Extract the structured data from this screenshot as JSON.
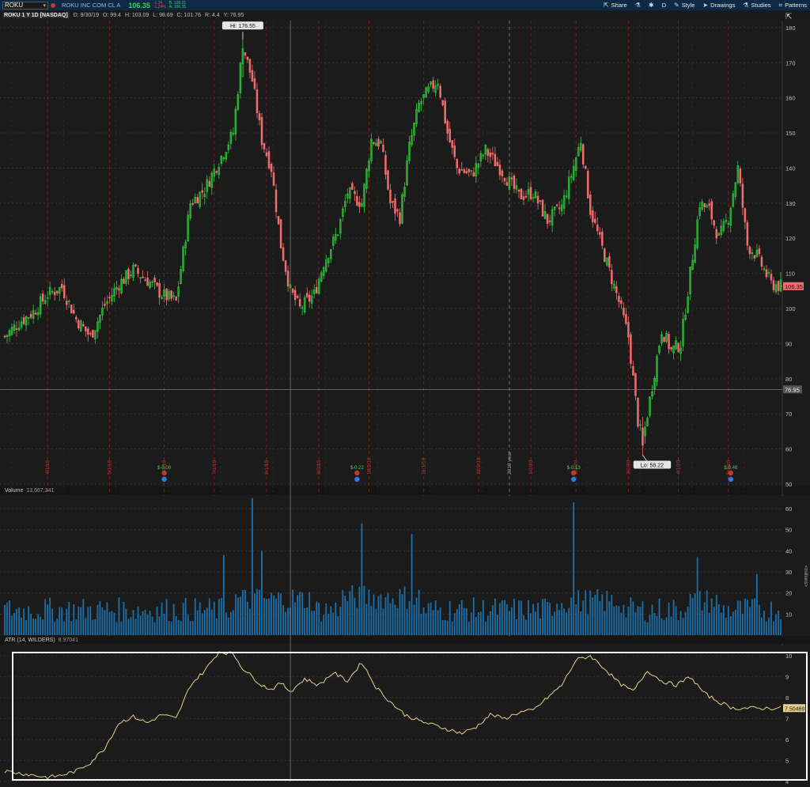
{
  "toolbar": {
    "symbol": "ROKU",
    "company": "ROKU INC COM CL A",
    "last": "106.35",
    "change": "-1.34",
    "change_pct": "-1.24%",
    "bid": "B: 106.31",
    "ask": "A: 106.35",
    "share_label": "Share",
    "aggregation_label": "D",
    "style_label": "Style",
    "drawings_label": "Drawings",
    "studies_label": "Studies",
    "patterns_label": "Patterns"
  },
  "info": {
    "title": "ROKU 1 Y 1D [NASDAQ]",
    "date": "D: 9/30/19",
    "open": "O: 99.4",
    "high": "H: 103.09",
    "low": "L: 98.69",
    "close": "C: 101.76",
    "range": "R: 4.4",
    "y": "Y: 76.95"
  },
  "price_panel": {
    "y_ticks": [
      "50",
      "60",
      "70",
      "80",
      "90",
      "100",
      "110",
      "120",
      "130",
      "140",
      "150",
      "160",
      "170",
      "180"
    ],
    "last_price_tag": "106.35",
    "crosshair_tag": "76.95",
    "hi_label": "Hi: 176.55",
    "lo_label": "Lo: 58.22",
    "dividend_labels": [
      "$-0.08",
      "$-0.22",
      "$-0.13",
      "$-0.46"
    ],
    "date_markers": [
      "4/1/19",
      "5/1/19",
      "6/3/19",
      "7/1/19",
      "8/1/19",
      "9/3/19",
      "10/1/19",
      "11/1/19",
      "12/2/19",
      "2019 year",
      "1/2/20",
      "2/3/20",
      "3/2/20",
      "4/1/20",
      "5/1/20"
    ]
  },
  "volume_panel": {
    "label": "Volume",
    "value": "13,667,341",
    "y_ticks": [
      "10",
      "20",
      "30",
      "40",
      "50",
      "60"
    ],
    "axis_title": "<millions>"
  },
  "atr_panel": {
    "label": "ATR (14, WILDERS)",
    "value": "8.97041",
    "last_tag": "7.50469",
    "y_ticks": [
      "4",
      "5",
      "6",
      "7",
      "8",
      "9",
      "10"
    ]
  },
  "colors": {
    "up": "#2fc93a",
    "down": "#f26d6d",
    "volume": "#1c6fa8",
    "atr": "#e7d08a",
    "topbar": "#0c2a46",
    "accent_green": "#39d353"
  },
  "chart_data": [
    {
      "type": "candlestick",
      "title": "ROKU 1 Y 1D [NASDAQ]",
      "ylim": [
        50,
        182
      ],
      "close_path": [
        [
          0,
          92
        ],
        [
          6,
          96
        ],
        [
          12,
          99
        ],
        [
          18,
          104
        ],
        [
          24,
          106
        ],
        [
          30,
          97
        ],
        [
          36,
          92
        ],
        [
          42,
          101
        ],
        [
          48,
          107
        ],
        [
          54,
          111
        ],
        [
          60,
          108
        ],
        [
          66,
          104
        ],
        [
          72,
          102
        ],
        [
          78,
          130
        ],
        [
          84,
          134
        ],
        [
          90,
          142
        ],
        [
          96,
          150
        ],
        [
          100,
          175
        ],
        [
          104,
          165
        ],
        [
          108,
          148
        ],
        [
          112,
          140
        ],
        [
          116,
          118
        ],
        [
          120,
          105
        ],
        [
          124,
          100
        ],
        [
          130,
          104
        ],
        [
          134,
          113
        ],
        [
          140,
          122
        ],
        [
          144,
          133
        ],
        [
          150,
          130
        ],
        [
          154,
          148
        ],
        [
          158,
          147
        ],
        [
          162,
          130
        ],
        [
          166,
          126
        ],
        [
          170,
          146
        ],
        [
          174,
          158
        ],
        [
          178,
          162
        ],
        [
          182,
          165
        ],
        [
          186,
          150
        ],
        [
          190,
          140
        ],
        [
          196,
          138
        ],
        [
          202,
          145
        ],
        [
          208,
          140
        ],
        [
          212,
          136
        ],
        [
          216,
          132
        ],
        [
          222,
          133
        ],
        [
          228,
          125
        ],
        [
          234,
          129
        ],
        [
          238,
          138
        ],
        [
          242,
          148
        ],
        [
          246,
          128
        ],
        [
          252,
          115
        ],
        [
          258,
          102
        ],
        [
          262,
          92
        ],
        [
          266,
          68
        ],
        [
          268,
          62
        ],
        [
          272,
          78
        ],
        [
          276,
          94
        ],
        [
          280,
          88
        ],
        [
          284,
          90
        ],
        [
          288,
          110
        ],
        [
          292,
          130
        ],
        [
          296,
          128
        ],
        [
          300,
          120
        ],
        [
          304,
          126
        ],
        [
          308,
          140
        ],
        [
          312,
          118
        ],
        [
          316,
          115
        ],
        [
          322,
          107
        ],
        [
          326,
          106.35
        ]
      ],
      "high": 176.55,
      "low": 58.22
    },
    {
      "type": "bar",
      "title": "Volume",
      "ylim": [
        0,
        66
      ],
      "spike_values": [
        65,
        53,
        48,
        63
      ],
      "typical_values": [
        10,
        15,
        20
      ]
    },
    {
      "type": "line",
      "title": "ATR (14, WILDERS)",
      "ylim": [
        4,
        10.5
      ],
      "x": [
        0,
        6,
        12,
        18,
        24,
        30,
        36,
        42,
        48,
        54,
        60,
        66,
        72,
        78,
        84,
        90,
        96,
        100,
        104,
        108,
        112,
        116,
        120,
        126,
        132,
        138,
        144,
        150,
        156,
        162,
        168,
        174,
        180,
        186,
        192,
        198,
        204,
        210,
        216,
        222,
        228,
        234,
        240,
        246,
        252,
        258,
        264,
        270,
        276,
        282,
        288,
        294,
        300,
        306,
        312,
        318,
        324,
        326
      ],
      "values": [
        4.5,
        4.4,
        4.3,
        4.2,
        4.3,
        4.5,
        4.9,
        5.6,
        6.8,
        7.1,
        6.8,
        7.2,
        7.0,
        8.6,
        9.3,
        10.2,
        10.1,
        9.4,
        9.0,
        8.6,
        8.4,
        8.7,
        8.3,
        8.9,
        8.6,
        9.2,
        8.8,
        9.7,
        8.5,
        7.8,
        7.2,
        6.9,
        6.7,
        6.5,
        6.3,
        6.6,
        7.2,
        7.0,
        7.3,
        7.4,
        8.0,
        8.6,
        9.8,
        10.0,
        9.4,
        8.7,
        8.3,
        9.3,
        8.8,
        8.6,
        9.0,
        8.2,
        7.8,
        7.5,
        7.5,
        7.5,
        7.5,
        7.5
      ]
    }
  ]
}
